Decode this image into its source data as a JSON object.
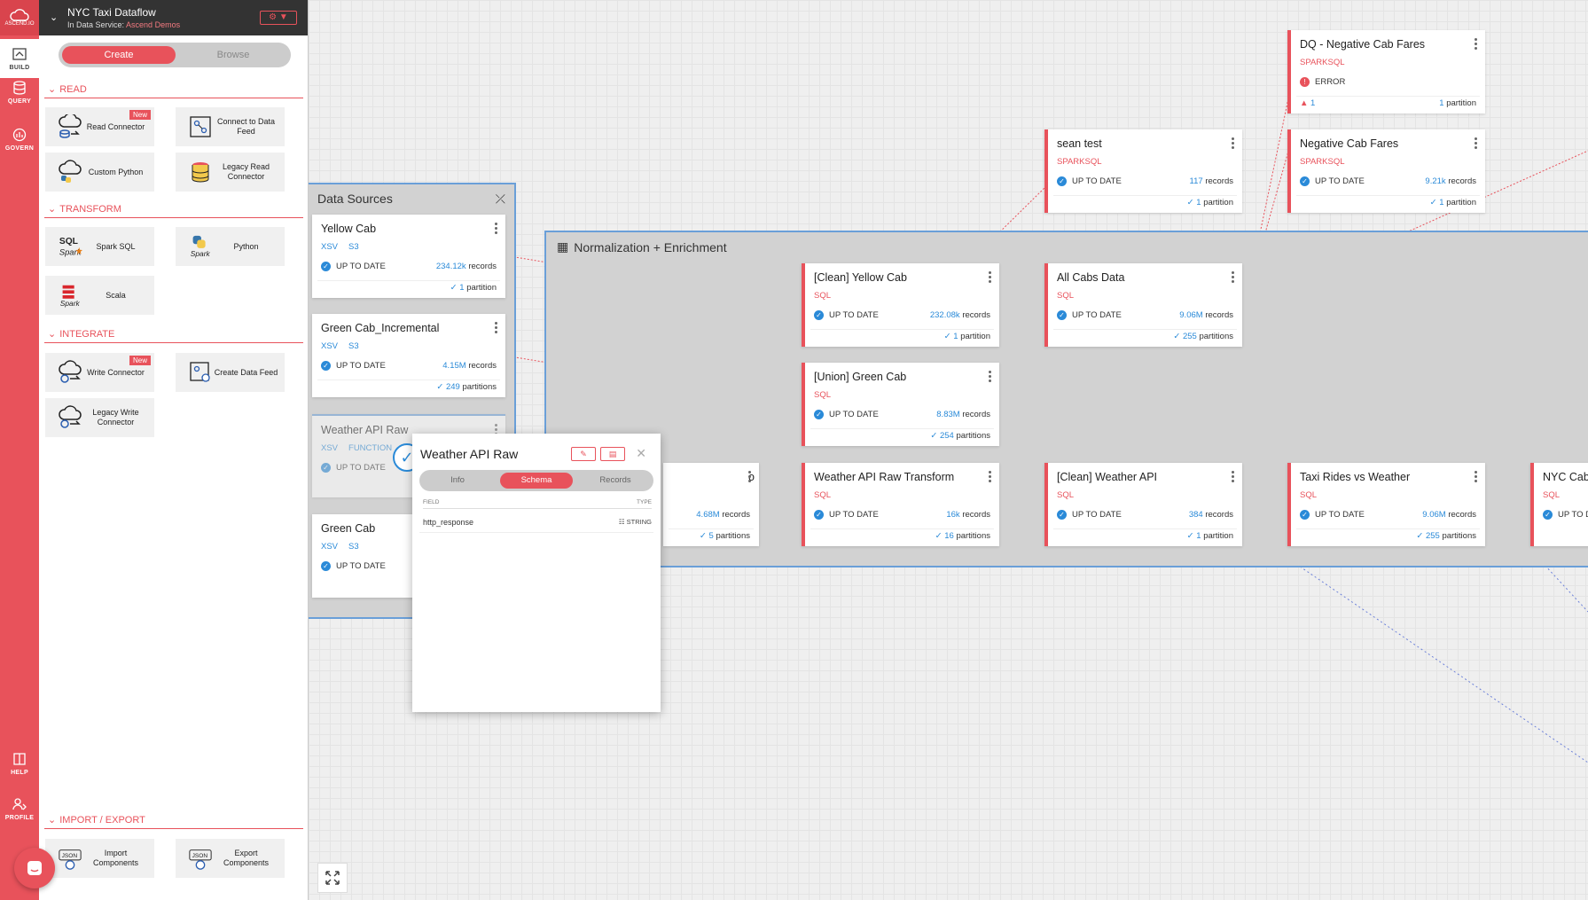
{
  "rail": {
    "logo": "ASCEND.IO",
    "items": [
      "BUILD",
      "QUERY",
      "GOVERN",
      "HELP",
      "PROFILE"
    ]
  },
  "panel": {
    "title": "NYC Taxi Dataflow",
    "service_prefix": "In Data Service:",
    "service_name": "Ascend Demos",
    "tab_create": "Create",
    "tab_browse": "Browse",
    "sections": {
      "read": "READ",
      "transform": "TRANSFORM",
      "integrate": "INTEGRATE",
      "import_export": "IMPORT / EXPORT"
    },
    "new_badge": "New",
    "tiles": {
      "read_connector": "Read Connector",
      "connect_feed": "Connect to Data Feed",
      "custom_python": "Custom Python",
      "legacy_read": "Legacy Read Connector",
      "spark_sql": "Spark SQL",
      "python": "Python",
      "scala": "Scala",
      "write_connector": "Write Connector",
      "create_feed": "Create Data Feed",
      "legacy_write": "Legacy Write Connector",
      "import_components": "Import Components",
      "export_components": "Export Components"
    }
  },
  "groups": {
    "data_sources": "Data Sources",
    "normalization": "Normalization + Enrichment"
  },
  "common": {
    "up_to_date": "UP TO DATE",
    "error": "ERROR",
    "records": "records",
    "partition": "partition",
    "partitions": "partitions"
  },
  "nodes": {
    "yellow_cab": {
      "title": "Yellow Cab",
      "tag1": "XSV",
      "tag2": "S3",
      "records": "234.12k",
      "parts": "1",
      "parts_label": "partition"
    },
    "green_inc": {
      "title": "Green Cab_Incremental",
      "tag1": "XSV",
      "tag2": "S3",
      "records": "4.15M",
      "parts": "249",
      "parts_label": "partitions"
    },
    "weather_raw": {
      "title": "Weather API Raw",
      "tag1": "XSV",
      "tag2": "FUNCTION"
    },
    "green_cab": {
      "title": "Green Cab",
      "tag1": "XSV",
      "tag2": "S3"
    },
    "hidden_node": {
      "title": "o",
      "records": "4.68M",
      "parts": "5",
      "parts_label": "partitions"
    },
    "clean_yellow": {
      "title": "[Clean] Yellow Cab",
      "tag": "SQL",
      "records": "232.08k",
      "parts": "1",
      "parts_label": "partition"
    },
    "union_green": {
      "title": "[Union] Green Cab",
      "tag": "SQL",
      "records": "8.83M",
      "parts": "254",
      "parts_label": "partitions"
    },
    "weather_transform": {
      "title": "Weather API Raw Transform",
      "tag": "SQL",
      "records": "16k",
      "parts": "16",
      "parts_label": "partitions"
    },
    "all_cabs": {
      "title": "All Cabs Data",
      "tag": "SQL",
      "records": "9.06M",
      "parts": "255",
      "parts_label": "partitions"
    },
    "clean_weather": {
      "title": "[Clean] Weather API",
      "tag": "SQL",
      "records": "384",
      "parts": "1",
      "parts_label": "partition"
    },
    "sean_test": {
      "title": "sean test",
      "tag": "SPARKSQL",
      "records": "117",
      "parts": "1",
      "parts_label": "partition"
    },
    "dq_negative": {
      "title": "DQ - Negative Cab Fares",
      "tag": "SPARKSQL",
      "warn": "1",
      "parts": "1",
      "parts_label": "partition"
    },
    "negative_fares": {
      "title": "Negative Cab Fares",
      "tag": "SPARKSQL",
      "records": "9.21k",
      "parts": "1",
      "parts_label": "partition"
    },
    "taxi_weather": {
      "title": "Taxi Rides vs Weather",
      "tag": "SQL",
      "records": "9.06M",
      "parts": "255",
      "parts_label": "partitions"
    },
    "nyc_cab": {
      "title": "NYC Cab",
      "tag": "SQL",
      "status": "UP TO D"
    }
  },
  "popup": {
    "title": "Weather API Raw",
    "tabs": [
      "Info",
      "Schema",
      "Records"
    ],
    "col_field": "FIELD",
    "col_type": "TYPE",
    "row_field": "http_response",
    "row_type": "STRING"
  },
  "colors": {
    "accent": "#e8525b",
    "link": "#2a8ad8",
    "group_border": "#6a9fd8"
  }
}
